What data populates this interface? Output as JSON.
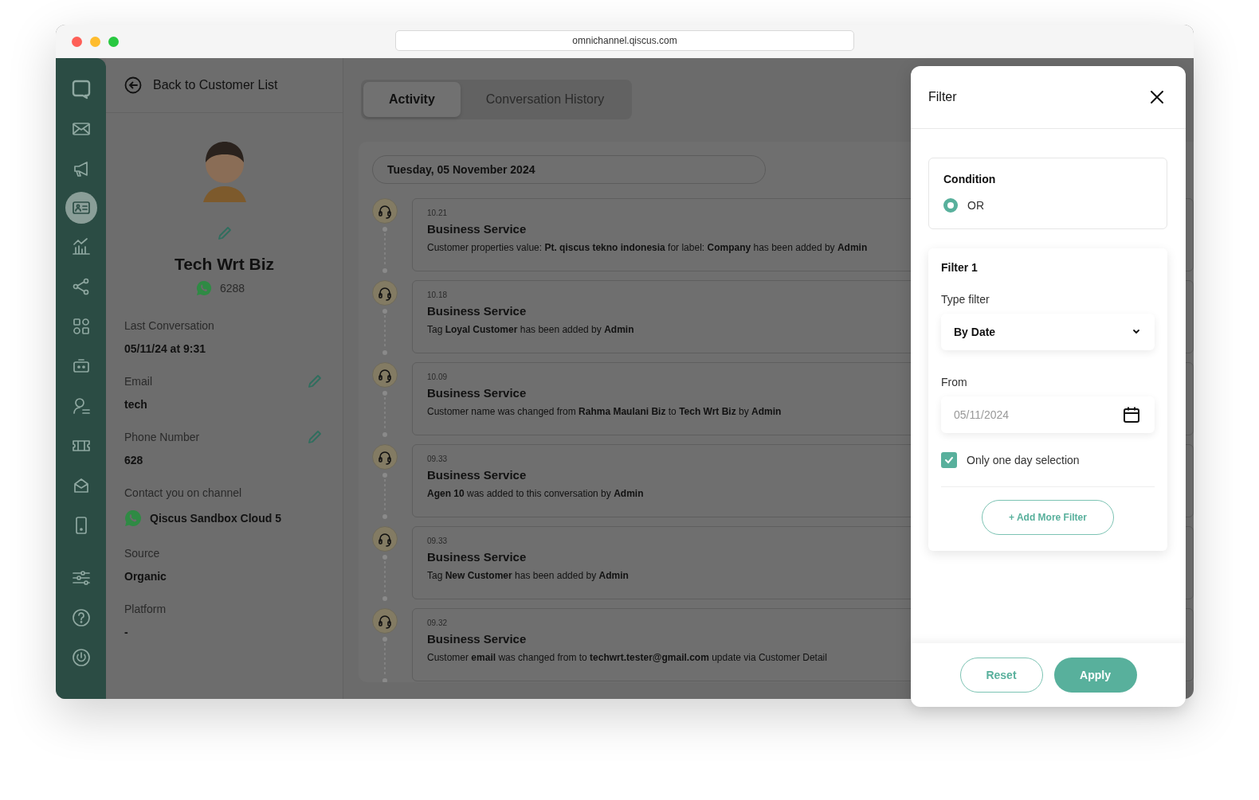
{
  "browser": {
    "url": "omnichannel.qiscus.com"
  },
  "nav_items": [
    {
      "selected": false
    },
    {
      "selected": false
    },
    {
      "selected": false
    },
    {
      "selected": true
    },
    {
      "selected": false
    },
    {
      "selected": false
    },
    {
      "selected": false
    },
    {
      "selected": false
    },
    {
      "selected": false
    },
    {
      "selected": false
    },
    {
      "selected": false
    },
    {
      "selected": false
    }
  ],
  "nav_bottom_items": [
    {
      "selected": false
    },
    {
      "selected": false
    },
    {
      "selected": false
    }
  ],
  "customer": {
    "back_label": "Back to Customer List",
    "name": "Tech Wrt Biz",
    "whatsapp_number": "6288",
    "fields": [
      {
        "kind": "text",
        "label": "Last Conversation",
        "value": "05/11/24 at 9:31",
        "editable": false
      },
      {
        "kind": "text",
        "label": "Email",
        "value": "tech",
        "editable": true
      },
      {
        "kind": "text",
        "label": "Phone Number",
        "value": "628",
        "editable": true
      },
      {
        "kind": "channel",
        "label": "Contact you on channel",
        "value": "Qiscus Sandbox Cloud 5",
        "editable": false
      },
      {
        "kind": "text",
        "label": "Source",
        "value": "Organic",
        "editable": false
      },
      {
        "kind": "text",
        "label": "Platform",
        "value": "-",
        "editable": false
      }
    ]
  },
  "tabs": [
    {
      "label": "Activity",
      "selected": true
    },
    {
      "label": "Conversation History",
      "selected": false
    }
  ],
  "activity": {
    "date": "Tuesday, 05 November 2024",
    "items": [
      {
        "time": "10.21",
        "title": "Business Service",
        "description": "Customer properties value: **Pt. qiscus tekno indonesia** for label: **Company** has been added by **Admin**"
      },
      {
        "time": "10.18",
        "title": "Business Service",
        "description": "Tag **Loyal Customer** has been added by **Admin**"
      },
      {
        "time": "10.09",
        "title": "Business Service",
        "description": "Customer name was changed from **Rahma Maulani Biz** to **Tech Wrt Biz** by **Admin**"
      },
      {
        "time": "09.33",
        "title": "Business Service",
        "description": "**Agen 10** was added to this conversation by **Admin**"
      },
      {
        "time": "09.33",
        "title": "Business Service",
        "description": "Tag **New Customer** has been added by **Admin**"
      },
      {
        "time": "09.32",
        "title": "Business Service",
        "description": "Customer **email** was changed from to **techwrt.tester@gmail.com** update via Customer Detail"
      }
    ]
  },
  "filter": {
    "title": "Filter",
    "condition": {
      "label": "Condition",
      "options": [
        {
          "label": "OR",
          "selected": true
        }
      ]
    },
    "groups": [
      {
        "title": "Filter 1",
        "type_label": "Type filter",
        "type_value": "By Date",
        "from_label": "From",
        "from_value": "05/11/2024",
        "one_day": {
          "label": "Only one day selection",
          "checked": true
        }
      }
    ],
    "add_button": "+ Add More Filter",
    "reset_button": "Reset",
    "apply_button": "Apply"
  }
}
